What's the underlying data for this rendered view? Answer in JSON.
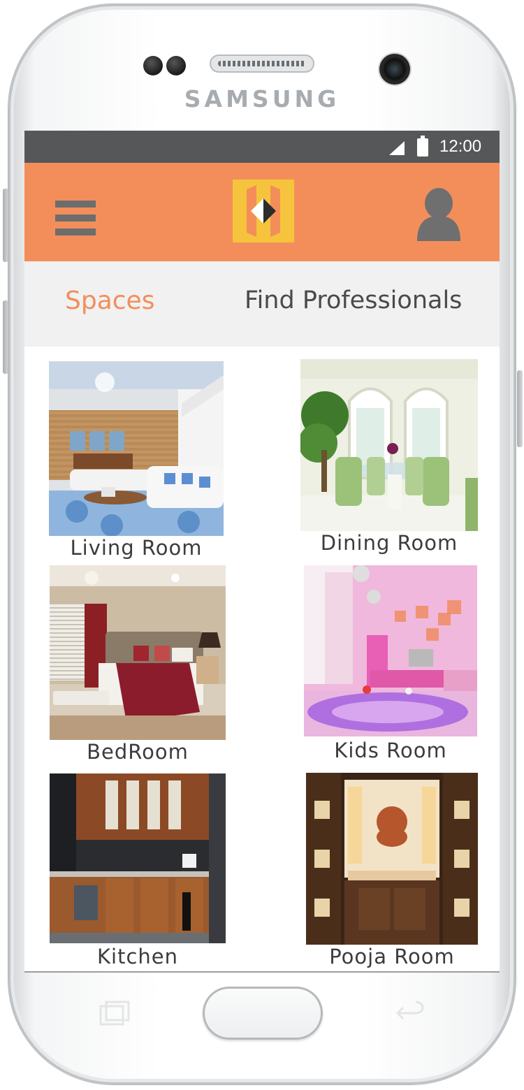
{
  "device": {
    "brand": "SAMSUNG"
  },
  "status_bar": {
    "time": "12:00",
    "icons": [
      "signal-icon",
      "battery-icon"
    ]
  },
  "app_bar": {
    "menu_icon": "hamburger-menu-icon",
    "logo_icon": "app-logo-icon",
    "profile_icon": "user-profile-icon",
    "color": "#f38e5a"
  },
  "tabs": [
    {
      "label": "Spaces",
      "active": true,
      "color": "#f38e5a"
    },
    {
      "label": "Find Professionals",
      "active": false,
      "color": "#4a4a4a"
    }
  ],
  "spaces": [
    {
      "label": "Living Room",
      "image": "living-room-photo"
    },
    {
      "label": "Dining Room",
      "image": "dining-room-photo"
    },
    {
      "label": "BedRoom",
      "image": "bedroom-photo"
    },
    {
      "label": "Kids Room",
      "image": "kids-room-photo"
    },
    {
      "label": "Kitchen",
      "image": "kitchen-photo"
    },
    {
      "label": "Pooja Room",
      "image": "pooja-room-photo"
    }
  ]
}
